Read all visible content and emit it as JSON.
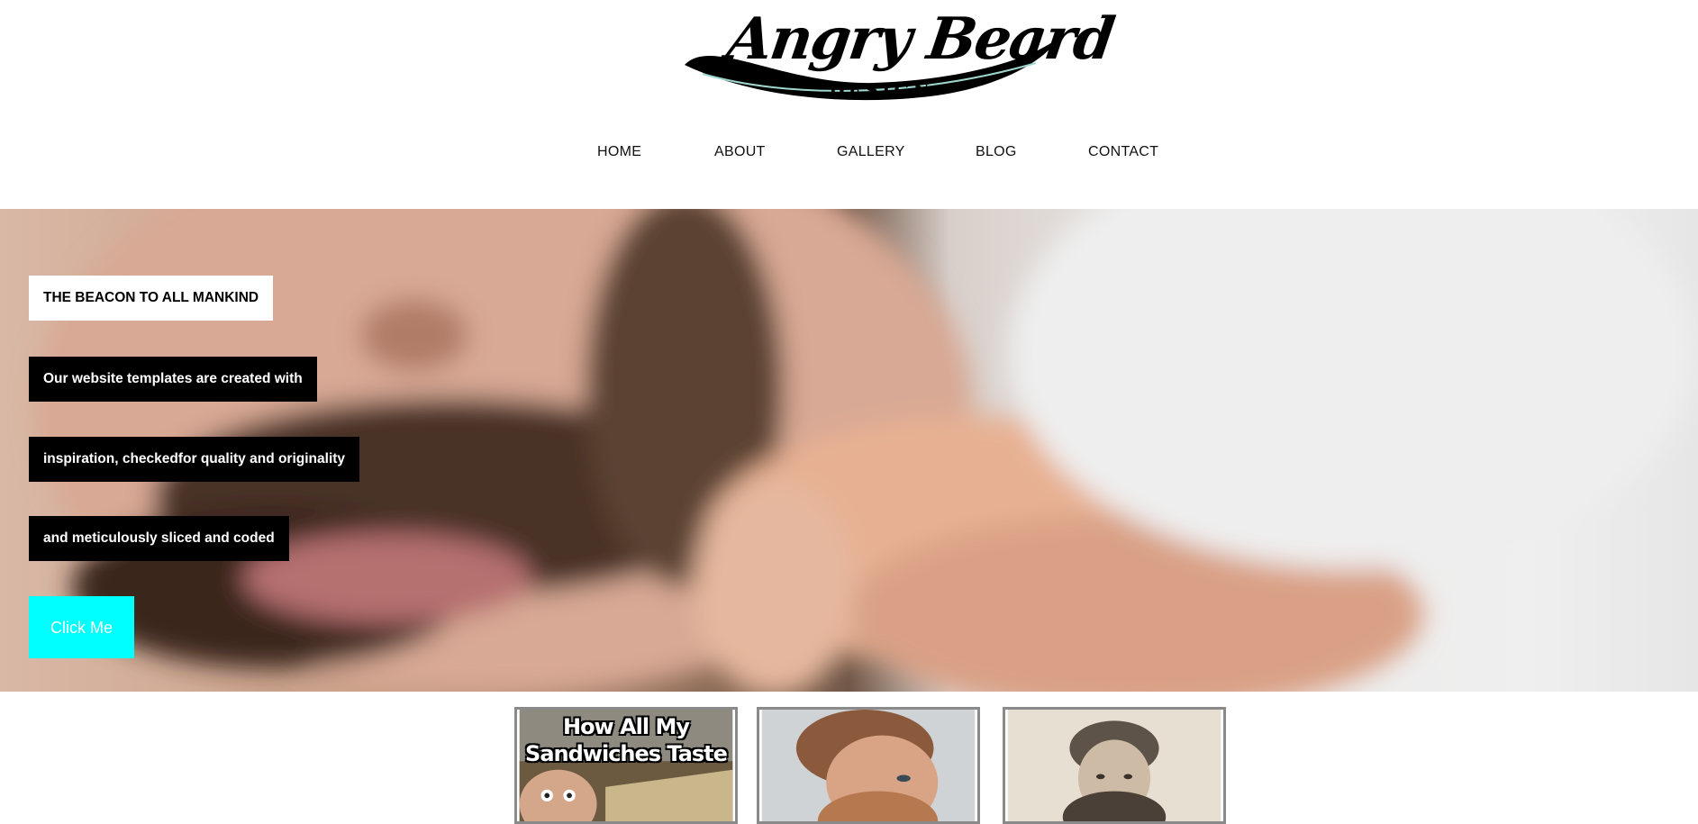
{
  "brand": {
    "name": "Angry Beard",
    "subtitle": "DESIGN"
  },
  "nav": {
    "items": [
      "HOME",
      "ABOUT",
      "GALLERY",
      "BLOG",
      "CONTACT"
    ]
  },
  "hero": {
    "headline": "THE BEACON TO ALL MANKIND",
    "lines": [
      "Our website templates are created with",
      "inspiration, checkedfor quality and originality",
      "and meticulously sliced and coded"
    ],
    "cta_label": "Click Me",
    "cta_color": "#00ffff"
  },
  "gallery": {
    "thumbnails": [
      {
        "caption": "How All My Sandwiches Taste"
      },
      {
        "caption": ""
      },
      {
        "caption": ""
      }
    ]
  }
}
